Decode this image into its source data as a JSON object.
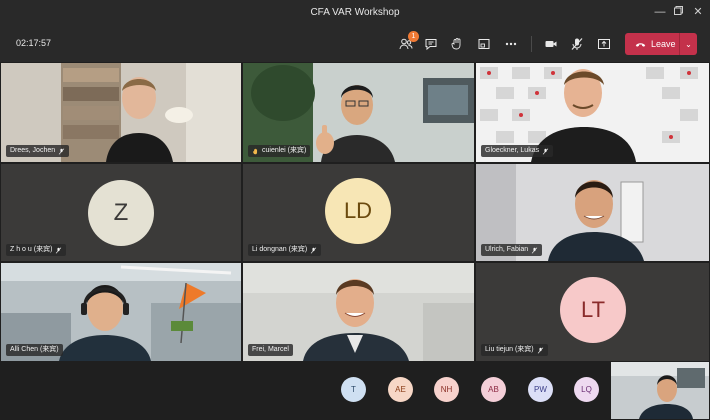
{
  "window": {
    "title": "CFA VAR Workshop"
  },
  "toolbar": {
    "timer": "02:17:57",
    "participants_badge": "1",
    "leave_label": "Leave"
  },
  "tiles": [
    {
      "name": "Drees, Jochen",
      "type": "video"
    },
    {
      "name": "cuienlei (来宾)",
      "type": "video",
      "hand_raised": true
    },
    {
      "name": "Gloeckner, Lukas",
      "type": "video"
    },
    {
      "name": "Z h o u (来宾)",
      "type": "avatar",
      "initials": "Z",
      "color": "#e4e1d3",
      "text_color": "#3b3a39"
    },
    {
      "name": "Li dongnan (来宾)",
      "type": "avatar",
      "initials": "LD",
      "color": "#f7e6b5",
      "text_color": "#6b4a0e"
    },
    {
      "name": "Ulrich, Fabian",
      "type": "video"
    },
    {
      "name": "Alli Chen (来宾)",
      "type": "video"
    },
    {
      "name": "Frei, Marcel",
      "type": "video"
    },
    {
      "name": "Liu tiejun (来宾)",
      "type": "avatar",
      "initials": "LT",
      "color": "#f7c9c9",
      "text_color": "#8a2b2b"
    }
  ],
  "overflow_avatars": [
    {
      "initials": "T",
      "color": "#cfe0f2",
      "text_color": "#2d4a6a"
    },
    {
      "initials": "AE",
      "color": "#f7d7c6",
      "text_color": "#8a3b16"
    },
    {
      "initials": "NH",
      "color": "#f7d2cd",
      "text_color": "#8a2f26"
    },
    {
      "initials": "AB",
      "color": "#f4cfd8",
      "text_color": "#8a2740"
    },
    {
      "initials": "PW",
      "color": "#dcdff7",
      "text_color": "#3c3f8a"
    },
    {
      "initials": "LQ",
      "color": "#eed9f0",
      "text_color": "#6a2e73"
    }
  ]
}
